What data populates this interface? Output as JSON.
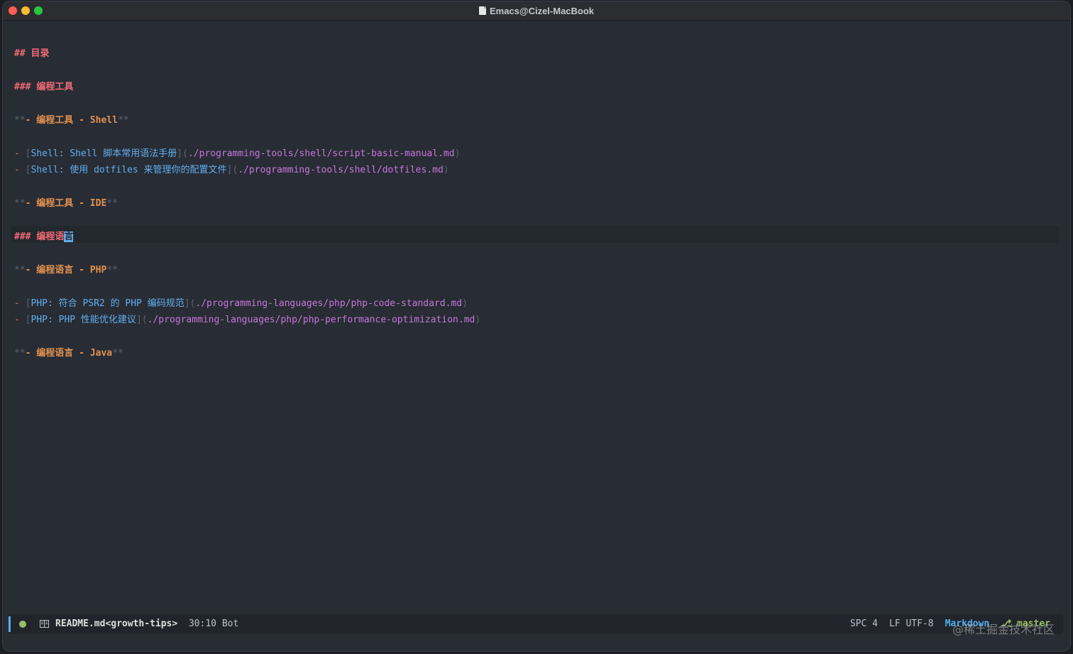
{
  "window": {
    "title": "Emacs@Cizel-MacBook"
  },
  "buffer": {
    "line_1": {
      "marker": "##",
      "text": "目录"
    },
    "line_2": {
      "marker": "###",
      "text": "编程工具"
    },
    "line_3": {
      "open": "**",
      "text": "- 编程工具 - Shell",
      "close": "**"
    },
    "line_4": {
      "bullet": "-",
      "lb": "[",
      "text": "Shell: Shell 脚本常用语法手册",
      "mid": "](",
      "url": "./programming-tools/shell/script-basic-manual.md",
      "rp": ")"
    },
    "line_5": {
      "bullet": "-",
      "lb": "[",
      "text": "Shell: 使用 dotfiles 来管理你的配置文件",
      "mid": "](",
      "url": "./programming-tools/shell/dotfiles.md",
      "rp": ")"
    },
    "line_6": {
      "open": "**",
      "text": "- 编程工具 - IDE",
      "close": "**"
    },
    "line_7": {
      "marker": "###",
      "text": "编程语",
      "cursor_char": "言"
    },
    "line_8": {
      "open": "**",
      "text": "- 编程语言 - PHP",
      "close": "**"
    },
    "line_9": {
      "bullet": "-",
      "lb": "[",
      "text": "PHP: 符合 PSR2 的 PHP 编码规范",
      "mid": "](",
      "url": "./programming-languages/php/php-code-standard.md",
      "rp": ")"
    },
    "line_10": {
      "bullet": "-",
      "lb": "[",
      "text": "PHP: PHP 性能优化建议",
      "mid": "](",
      "url": "./programming-languages/php/php-performance-optimization.md",
      "rp": ")"
    },
    "line_11": {
      "open": "**",
      "text": "- 编程语言 - Java",
      "close": "**"
    }
  },
  "modeline": {
    "filename": "README.md<growth-tips>",
    "position": "30:10",
    "scroll": "Bot",
    "indent": "SPC 4",
    "encoding": "LF UTF-8",
    "major_mode": "Markdown",
    "branch": "master"
  },
  "watermark": "@稀土掘金技术社区"
}
